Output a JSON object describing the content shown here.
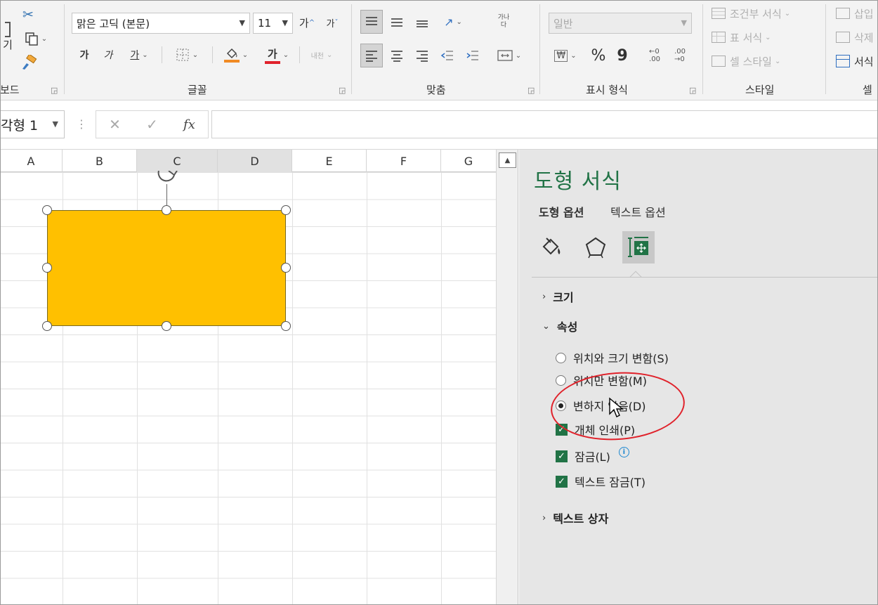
{
  "ribbon": {
    "clipboard": {
      "paste_fragment": "기",
      "group_label": "보드"
    },
    "font": {
      "font_name": "맑은 고딕 (본문)",
      "font_size": "11",
      "grow_label": "가",
      "shrink_label": "가",
      "bold_label": "가",
      "italic_label": "가",
      "underline_label": "가",
      "font_color_label": "가",
      "phonetic_label": "내천",
      "group_label": "글꼴",
      "fill_color": "#f08a24",
      "font_color": "#e0222b"
    },
    "alignment": {
      "wrap_label": "가나다",
      "group_label": "맞춤"
    },
    "number": {
      "format": "일반",
      "percent": "%",
      "comma": "9",
      "group_label": "표시 형식"
    },
    "styles": {
      "conditional": "조건부 서식",
      "table_format": "표 서식",
      "cell_styles": "셀 스타일",
      "group_label": "스타일"
    },
    "cells": {
      "insert": "삽입",
      "delete": "삭제",
      "format": "서식",
      "group_label": "셀"
    }
  },
  "formula_bar": {
    "name_box": "각형 1",
    "cancel": "✕",
    "enter": "✓",
    "fx": "fx",
    "value": ""
  },
  "sheet": {
    "columns": [
      "A",
      "B",
      "C",
      "D",
      "E",
      "F",
      "G"
    ],
    "shape_color": "#ffc000"
  },
  "pane": {
    "title": "도형 서식",
    "tabs": [
      "도형 옵션",
      "텍스트 옵션"
    ],
    "sections": {
      "size": "크기",
      "properties": "속성",
      "textbox": "텍스트 상자"
    },
    "options": {
      "move_size": "위치와 크기 변함(S)",
      "move_only": "위치만 변함(M)",
      "no_move": "변하지 않음(D)",
      "print_object": "개체 인쇄(P)",
      "locked": "잠금(L)",
      "lock_text": "텍스트 잠금(T)"
    },
    "selected_option": "no_move",
    "accent": "#217346"
  }
}
